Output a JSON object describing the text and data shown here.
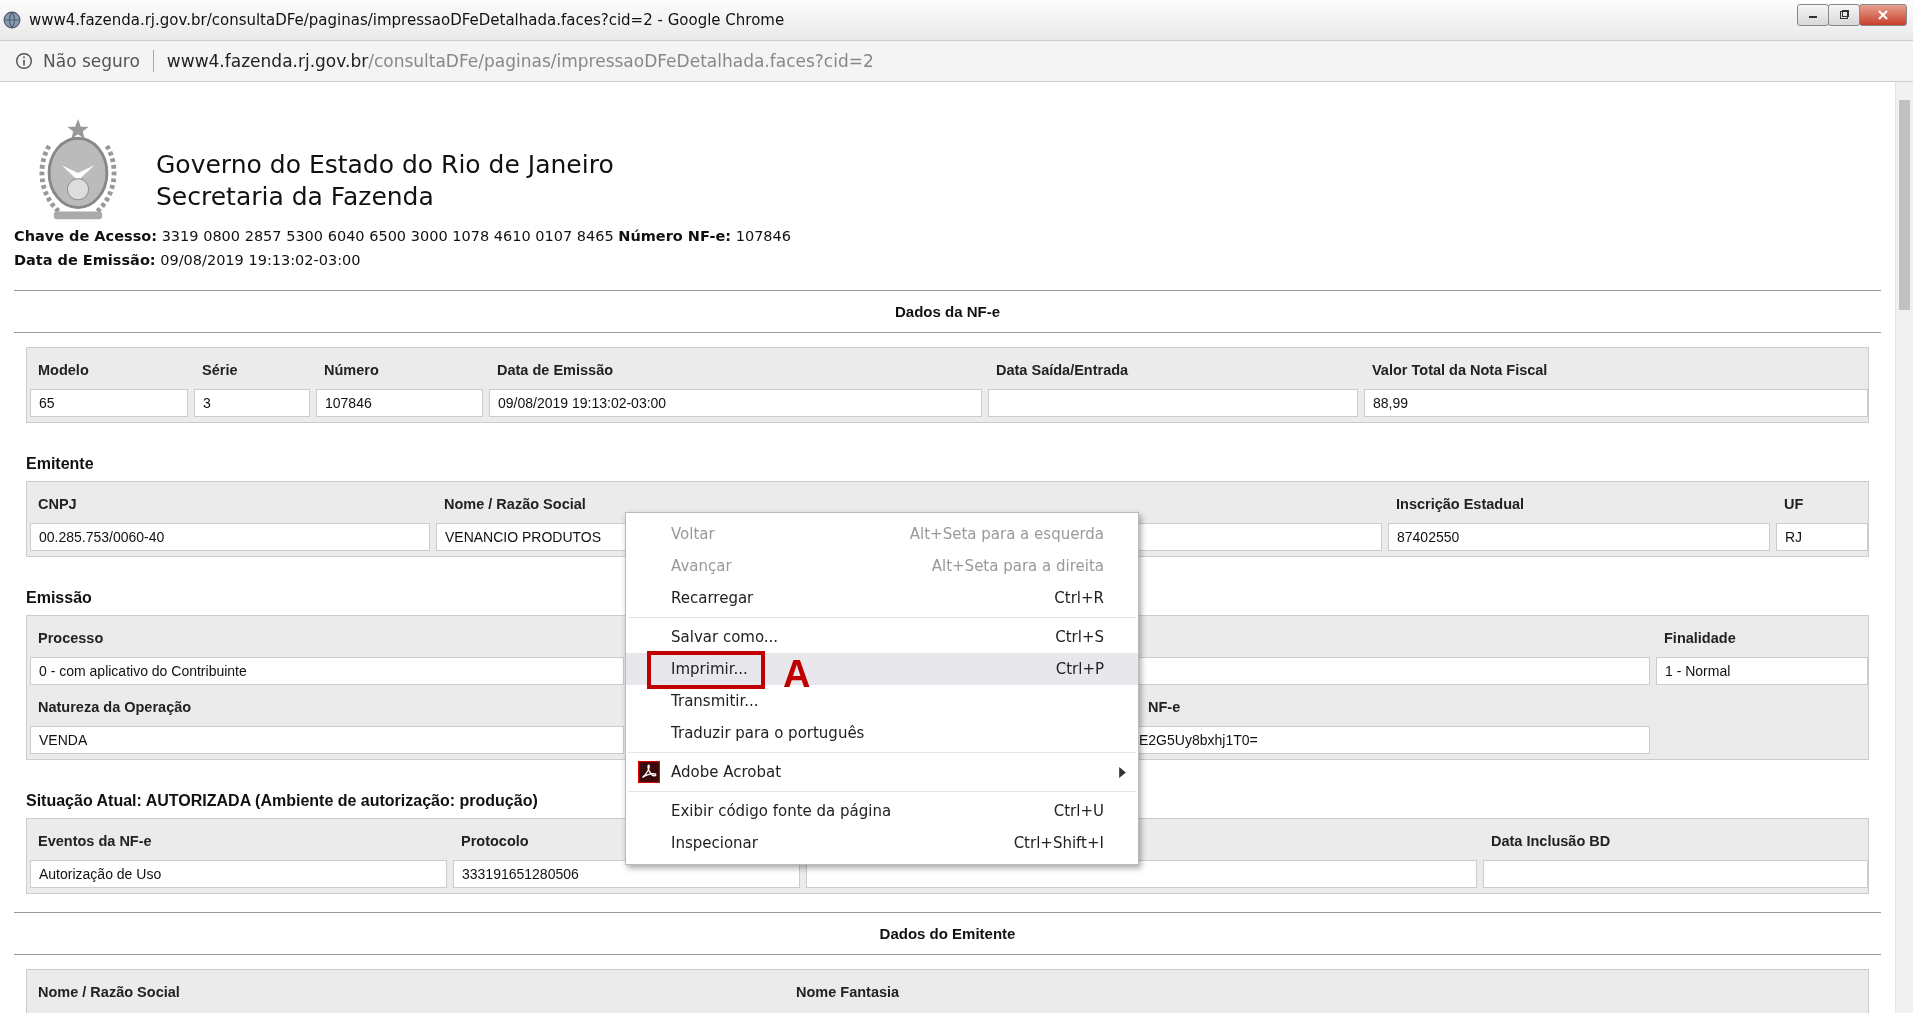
{
  "window": {
    "title": "www4.fazenda.rj.gov.br/consultaDFe/paginas/impressaoDFeDetalhada.faces?cid=2 - Google Chrome"
  },
  "address_bar": {
    "security": "Não seguro",
    "host": "www4.fazenda.rj.gov.br",
    "path": "/consultaDFe/paginas/impressaoDFeDetalhada.faces?cid=2"
  },
  "header": {
    "title_lines": [
      "Governo do Estado do Rio de Janeiro",
      "Secretaria da Fazenda"
    ],
    "info_lines": [
      "**Chave de Acesso:** 3319 0800 2857 5300 6040 6500 3000 1078 4610 0107 8465 **Número NF-e:** 107846",
      "**Data de Emissão:** 09/08/2019 19:13:02-03:00"
    ]
  },
  "blocks": [
    {
      "kind": "banner",
      "heading": "Dados da NF-e"
    },
    {
      "kind": "group",
      "rows": [
        [
          {
            "kind": "input",
            "label": "Modelo",
            "value": "65"
          },
          {
            "kind": "input",
            "label": "Série",
            "value": "3"
          },
          {
            "kind": "input",
            "label": "Número",
            "value": "107846"
          },
          {
            "kind": "input",
            "label": "Data de Emissão",
            "value": "09/08/2019 19:13:02-03:00"
          },
          {
            "kind": "input",
            "label": "Data Saída/Entrada"
          },
          {
            "kind": "input",
            "label": "Valor Total da Nota Fiscal",
            "value": "88,99"
          }
        ]
      ]
    },
    {
      "kind": "group",
      "title": "Emitente",
      "rows": [
        [
          {
            "kind": "input",
            "label": "CNPJ",
            "value": "00.285.753/0060-40"
          },
          {
            "kind": "input",
            "label": "Nome / Razão Social",
            "value": "VENANCIO PRODUTOS"
          },
          {
            "kind": "input",
            "label": "Inscrição Estadual",
            "value": "87402550"
          },
          {
            "kind": "input",
            "label": "UF",
            "value": "RJ"
          }
        ]
      ]
    },
    {
      "kind": "group",
      "title": "Emissão",
      "rows": [
        [
          {
            "kind": "input",
            "label": "Processo",
            "value": "0 - com aplicativo do Contribuinte"
          },
          {
            "kind": "input"
          },
          {
            "kind": "input",
            "label": "Finalidade",
            "value": "1 - Normal"
          }
        ],
        [
          {
            "kind": "input",
            "label": "Natureza da Operação",
            "value": "VENDA"
          },
          {
            "kind": "caption"
          },
          {
            "kind": "input",
            "label": "NF-e",
            "value": "E2G5Uy8bxhj1T0="
          }
        ]
      ]
    },
    {
      "kind": "group",
      "title": "Situação Atual: AUTORIZADA (Ambiente de autorização: produção)",
      "rows": [
        [
          {
            "kind": "input",
            "label": "Eventos da NF-e",
            "value": "Autorização de Uso"
          },
          {
            "kind": "input",
            "label": "Protocolo",
            "value": "333191651280506"
          },
          {
            "kind": "input"
          },
          {
            "kind": "input",
            "label": "Data Inclusão BD"
          }
        ]
      ]
    },
    {
      "kind": "banner",
      "heading": "Dados do Emitente"
    },
    {
      "kind": "group",
      "rows": [
        [
          {
            "kind": "caption",
            "label": "Nome / Razão Social"
          },
          {
            "kind": "caption",
            "label": "Nome Fantasia"
          }
        ]
      ]
    }
  ],
  "context_menu": {
    "items": [
      {
        "kind": "item",
        "label": "Voltar",
        "shortcut": "Alt+Seta para a esquerda",
        "disabled": true,
        "selected": false
      },
      {
        "kind": "item",
        "label": "Avançar",
        "shortcut": "Alt+Seta para a direita",
        "disabled": true,
        "selected": false
      },
      {
        "kind": "item",
        "label": "Recarregar",
        "shortcut": "Ctrl+R",
        "disabled": false,
        "selected": false
      },
      {
        "kind": "separator"
      },
      {
        "kind": "item",
        "label": "Salvar como...",
        "shortcut": "Ctrl+S",
        "disabled": false,
        "selected": false
      },
      {
        "kind": "item",
        "label": "Imprimir...",
        "shortcut": "Ctrl+P",
        "disabled": false,
        "selected": true,
        "annotation": "A"
      },
      {
        "kind": "item",
        "label": "Transmitir...",
        "disabled": false,
        "selected": false
      },
      {
        "kind": "item",
        "label": "Traduzir para o português",
        "disabled": false,
        "selected": false
      },
      {
        "kind": "separator"
      },
      {
        "kind": "submenu",
        "label": "Adobe Acrobat",
        "disabled": false,
        "selected": false
      },
      {
        "kind": "separator"
      },
      {
        "kind": "item",
        "label": "Exibir código fonte da página",
        "shortcut": "Ctrl+U",
        "disabled": false,
        "selected": false
      },
      {
        "kind": "item",
        "label": "Inspecionar",
        "shortcut": "Ctrl+Shift+I",
        "disabled": false,
        "selected": false
      }
    ]
  }
}
